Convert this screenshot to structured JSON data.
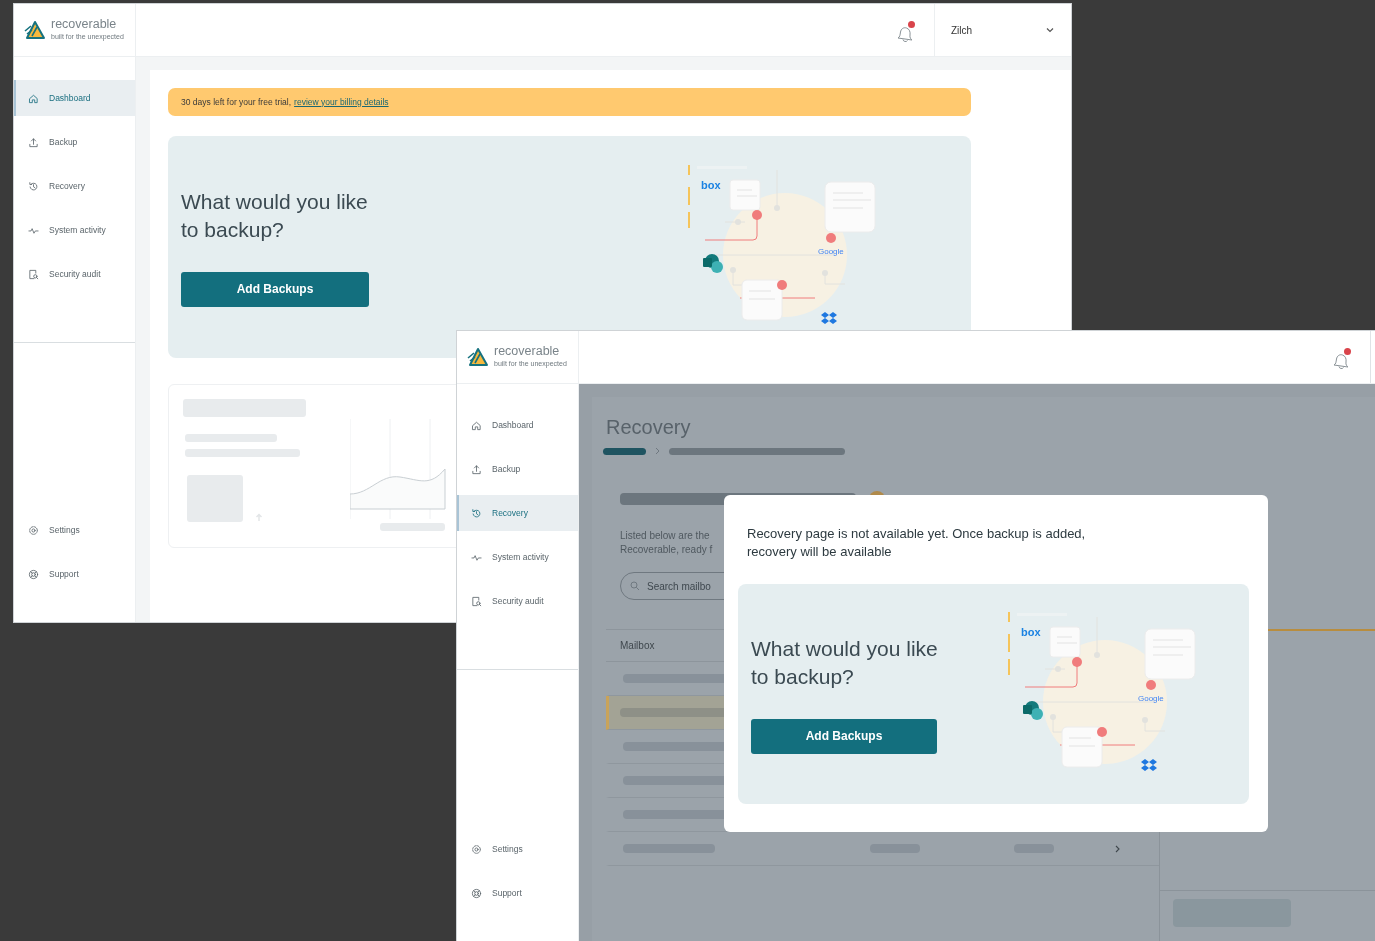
{
  "windows": [
    {
      "kind": "dashboard",
      "logo": {
        "name": "recoverable",
        "tagline": "built for the unexpected"
      },
      "header": {
        "notifications_unread": true,
        "account": "Zilch"
      },
      "sidebar": {
        "items": [
          {
            "label": "Dashboard",
            "selected": true
          },
          {
            "label": "Backup",
            "selected": false
          },
          {
            "label": "Recovery",
            "selected": false
          },
          {
            "label": "System activity",
            "selected": false
          },
          {
            "label": "Security audit",
            "selected": false
          }
        ],
        "footer_items": [
          {
            "label": "Settings"
          },
          {
            "label": "Support"
          }
        ]
      },
      "banner": {
        "text": "30 days left for your free trial, ",
        "link": "review your billing details"
      },
      "hero": {
        "title": "What would you like to backup?",
        "button": "Add Backups",
        "logos": [
          "box",
          "Google"
        ]
      }
    },
    {
      "kind": "recovery",
      "logo": {
        "name": "recoverable",
        "tagline": "built for the unexpected"
      },
      "header": {
        "notifications_unread": true
      },
      "sidebar": {
        "items": [
          {
            "label": "Dashboard",
            "selected": false
          },
          {
            "label": "Backup",
            "selected": false
          },
          {
            "label": "Recovery",
            "selected": true
          },
          {
            "label": "System activity",
            "selected": false
          },
          {
            "label": "Security audit",
            "selected": false
          }
        ],
        "footer_items": [
          {
            "label": "Settings"
          },
          {
            "label": "Support"
          }
        ]
      },
      "page": {
        "title": "Recovery",
        "description": [
          "Listed below are the",
          "Recoverable, ready f"
        ],
        "search": {
          "placeholder": "Search mailbo"
        },
        "table": {
          "columns": [
            "Mailbox"
          ],
          "rows": [
            {
              "selected": false
            },
            {
              "selected": true
            },
            {
              "selected": false
            },
            {
              "selected": false
            },
            {
              "selected": false
            },
            {
              "selected": false
            }
          ]
        }
      },
      "modal": {
        "message": "Recovery page is not available yet. Once backup is added, recovery will be available",
        "hero": {
          "title": "What would you like to backup?",
          "button": "Add Backups",
          "logos": [
            "box",
            "Google"
          ]
        }
      }
    }
  ]
}
